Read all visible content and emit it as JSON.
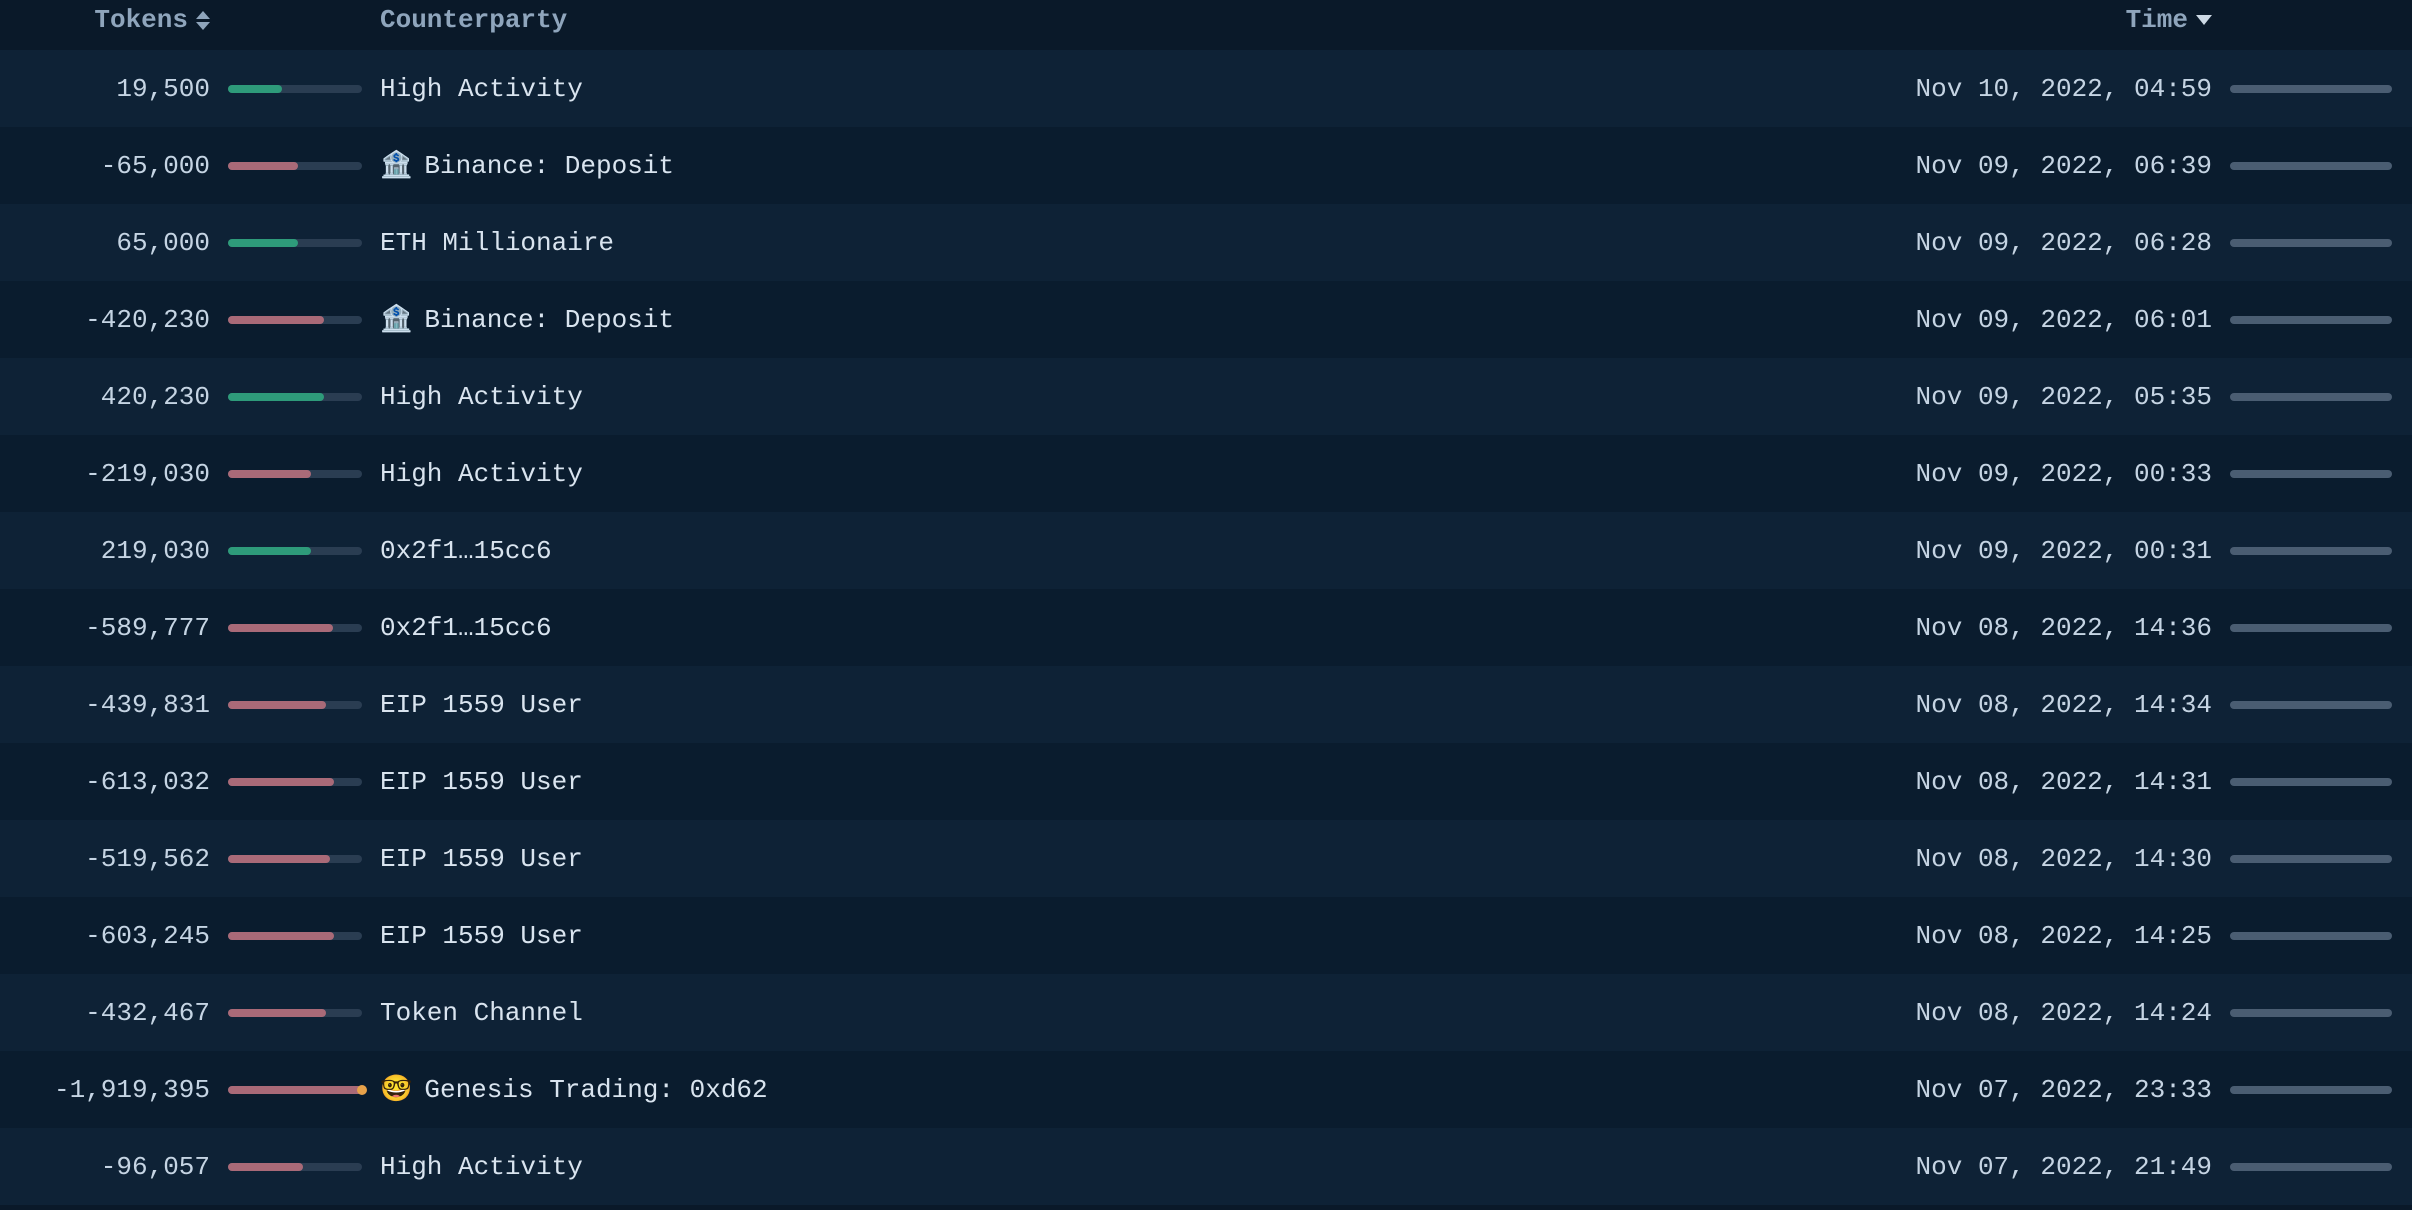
{
  "columns": {
    "tokens_label": "Tokens",
    "counterparty_label": "Counterparty",
    "time_label": "Time"
  },
  "max_abs_tokens": 1919395,
  "rows": [
    {
      "tokens": 19500,
      "tokens_display": "19,500",
      "token_bar_pct": 40,
      "counterparty": "High Activity",
      "cp_icon": "",
      "time": "Nov 10, 2022, 04:59",
      "time_bar_dot": false
    },
    {
      "tokens": -65000,
      "tokens_display": "-65,000",
      "token_bar_pct": 52,
      "counterparty": "Binance: Deposit",
      "cp_icon": "🏦",
      "time": "Nov 09, 2022, 06:39",
      "time_bar_dot": false
    },
    {
      "tokens": 65000,
      "tokens_display": "65,000",
      "token_bar_pct": 52,
      "counterparty": "ETH Millionaire",
      "cp_icon": "",
      "time": "Nov 09, 2022, 06:28",
      "time_bar_dot": false
    },
    {
      "tokens": -420230,
      "tokens_display": "-420,230",
      "token_bar_pct": 72,
      "counterparty": "Binance: Deposit",
      "cp_icon": "🏦",
      "time": "Nov 09, 2022, 06:01",
      "time_bar_dot": false
    },
    {
      "tokens": 420230,
      "tokens_display": "420,230",
      "token_bar_pct": 72,
      "counterparty": "High Activity",
      "cp_icon": "",
      "time": "Nov 09, 2022, 05:35",
      "time_bar_dot": false
    },
    {
      "tokens": -219030,
      "tokens_display": "-219,030",
      "token_bar_pct": 62,
      "counterparty": "High Activity",
      "cp_icon": "",
      "time": "Nov 09, 2022, 00:33",
      "time_bar_dot": false
    },
    {
      "tokens": 219030,
      "tokens_display": "219,030",
      "token_bar_pct": 62,
      "counterparty": "0x2f1…15cc6",
      "cp_icon": "",
      "time": "Nov 09, 2022, 00:31",
      "time_bar_dot": false
    },
    {
      "tokens": -589777,
      "tokens_display": "-589,777",
      "token_bar_pct": 78,
      "counterparty": "0x2f1…15cc6",
      "cp_icon": "",
      "time": "Nov 08, 2022, 14:36",
      "time_bar_dot": false
    },
    {
      "tokens": -439831,
      "tokens_display": "-439,831",
      "token_bar_pct": 73,
      "counterparty": "EIP 1559 User",
      "cp_icon": "",
      "time": "Nov 08, 2022, 14:34",
      "time_bar_dot": false
    },
    {
      "tokens": -613032,
      "tokens_display": "-613,032",
      "token_bar_pct": 79,
      "counterparty": "EIP 1559 User",
      "cp_icon": "",
      "time": "Nov 08, 2022, 14:31",
      "time_bar_dot": false
    },
    {
      "tokens": -519562,
      "tokens_display": "-519,562",
      "token_bar_pct": 76,
      "counterparty": "EIP 1559 User",
      "cp_icon": "",
      "time": "Nov 08, 2022, 14:30",
      "time_bar_dot": false
    },
    {
      "tokens": -603245,
      "tokens_display": "-603,245",
      "token_bar_pct": 79,
      "counterparty": "EIP 1559 User",
      "cp_icon": "",
      "time": "Nov 08, 2022, 14:25",
      "time_bar_dot": false
    },
    {
      "tokens": -432467,
      "tokens_display": "-432,467",
      "token_bar_pct": 73,
      "counterparty": "Token Channel",
      "cp_icon": "",
      "time": "Nov 08, 2022, 14:24",
      "time_bar_dot": false
    },
    {
      "tokens": -1919395,
      "tokens_display": "-1,919,395",
      "token_bar_pct": 100,
      "counterparty": "Genesis Trading: 0xd62",
      "cp_icon": "🤓",
      "time": "Nov 07, 2022, 23:33",
      "time_bar_dot": true
    },
    {
      "tokens": -96057,
      "tokens_display": "-96,057",
      "token_bar_pct": 56,
      "counterparty": "High Activity",
      "cp_icon": "",
      "time": "Nov 07, 2022, 21:49",
      "time_bar_dot": false
    }
  ]
}
